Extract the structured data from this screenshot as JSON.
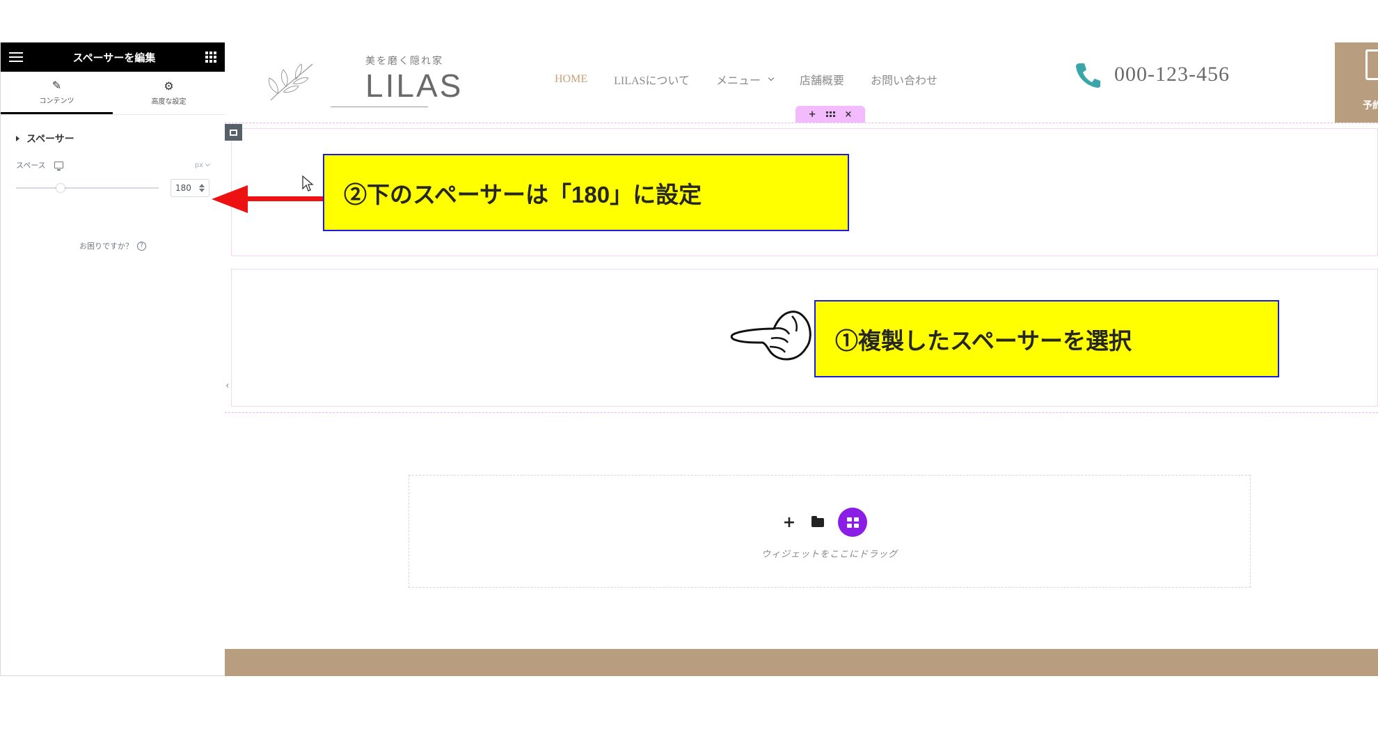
{
  "panel": {
    "title": "スペーサーを編集",
    "tabs": [
      {
        "label": "コンテンツ",
        "icon": "pencil-icon"
      },
      {
        "label": "高度な設定",
        "icon": "gear-icon"
      }
    ],
    "section_title": "スペーサー",
    "space_label": "スペース",
    "unit": "px",
    "space_value": "180",
    "help_text": "お困りですか？",
    "help_icon_glyph": "?"
  },
  "site": {
    "logo_tagline": "美を磨く隠れ家",
    "logo_name": "LILAS",
    "nav": [
      {
        "label": "HOME"
      },
      {
        "label": "LILASについて"
      },
      {
        "label": "メニュー"
      },
      {
        "label": "店舗概要"
      },
      {
        "label": "お問い合わせ"
      }
    ],
    "phone": "000-123-456",
    "reserve_label": "予約",
    "accent_color": "#c6a17a",
    "brand_color": "#b89d7e",
    "phone_icon_color": "#3aa6a8"
  },
  "section_handle": {
    "add": "+",
    "close": "×"
  },
  "callouts": {
    "step1": "①複製したスペーサーを選択",
    "step2": "②下のスペーサーは「180」に設定"
  },
  "drop_zone": {
    "add": "+",
    "text": "ウィジェットをここにドラッグ"
  }
}
